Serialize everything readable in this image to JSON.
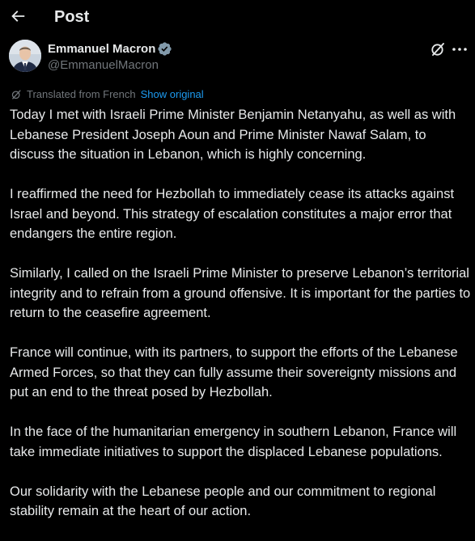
{
  "header": {
    "title": "Post",
    "back_icon": "arrow-left-icon"
  },
  "author": {
    "name": "Emmanuel Macron",
    "handle": "@EmmanuelMacron",
    "verified_icon": "verified-badge-icon",
    "verified_color": "#829aab"
  },
  "actions": {
    "grok_icon": "grok-icon",
    "more_icon": "more-horizontal-icon"
  },
  "translation": {
    "icon": "translate-icon",
    "label": "Translated from French",
    "show_original": "Show original"
  },
  "post": {
    "paragraphs": [
      "Today I met with Israeli Prime Minister Benjamin Netanyahu, as well as with Lebanese President Joseph Aoun and Prime Minister Nawaf Salam, to discuss the situation in Lebanon, which is highly concerning.",
      "I reaffirmed the need for Hezbollah to immediately cease its attacks against Israel and beyond. This strategy of escalation constitutes a major error that endangers the entire region.",
      "Similarly, I called on the Israeli Prime Minister to preserve Lebanon’s territorial integrity and to refrain from a ground offensive. It is important for the parties to return to the ceasefire agreement.",
      "France will continue, with its partners, to support the efforts of the Lebanese Armed Forces, so that they can fully assume their sovereignty missions and put an end to the threat posed by Hezbollah.",
      "In the face of the humanitarian emergency in southern Lebanon, France will take immediate initiatives to support the displaced Lebanese populations.",
      "Our solidarity with the Lebanese people and our commitment to regional stability remain at the heart of our action."
    ]
  },
  "colors": {
    "background": "#000000",
    "text_primary": "#e7e9ea",
    "text_secondary": "#71767b",
    "link": "#1d9bf0"
  }
}
